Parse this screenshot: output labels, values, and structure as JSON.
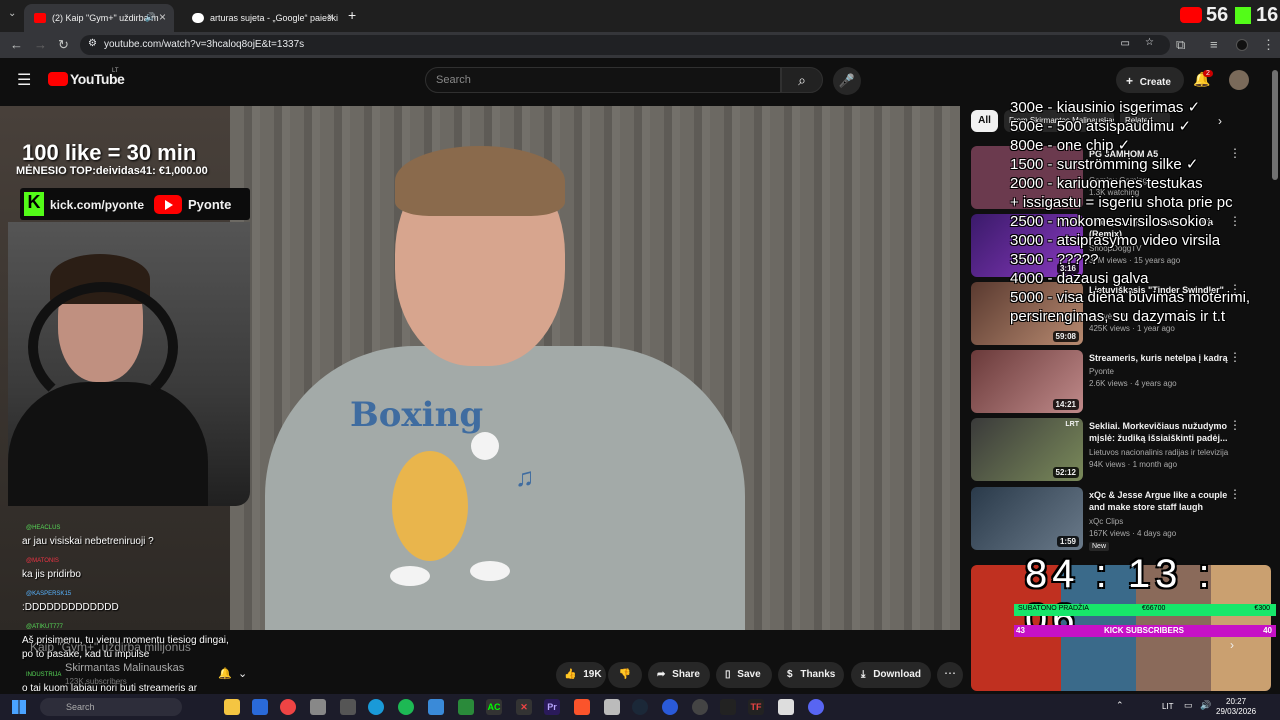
{
  "browser": {
    "tabs": [
      {
        "title": "(2) Kaip \"Gym+\" uždirba m",
        "favicon_color": "#ff0000"
      },
      {
        "title": "arturas sujeta - „Google“ paieški",
        "favicon_color": "#4285f4"
      }
    ],
    "new_tab": "+",
    "url": "youtube.com/watch?v=3hcaloq8ojE&t=1337s"
  },
  "youtube": {
    "logo": "YouTube",
    "logo_country": "LT",
    "search_placeholder": "Search",
    "create_label": "Create",
    "notification_count": "2"
  },
  "stream_overlay": {
    "likes_goal": "100 like = 30 min",
    "month_top": "MĖNESIO TOP:deividas41: €1,000.00",
    "kick_url": "kick.com/pyonte",
    "yt_channel": "Pyonte",
    "counter": "56",
    "counter_k": "16",
    "goals": [
      "300e - kiausinio isgerimas ✓",
      "500e - 500 atsispaudimu ✓",
      "800e - one chip ✓",
      "1500 - surströmming silke ✓",
      "2000 - kariuomenes testukas",
      "+ issigastu = isgeriu shota prie pc",
      "2500 - mokomesvirsilos sokio:",
      "3000 - atsiprasymo video virsila",
      "3500 - ?????",
      "4000 - dazausi galva",
      "5000 - visa diena buvimas moterimi,",
      "persirengimas, su dazymais ir t.t"
    ],
    "timer": "84 : 13 : 06",
    "subathon_label": "SUBATONO PRADŽIA",
    "subathon_mid": "€66700",
    "subathon_right": "€300",
    "kick_subs_left": "43",
    "kick_subs_label": "KICK SUBSCRIBERS",
    "kick_subs_right": "40",
    "chat": [
      {
        "user": "@HEACLUS",
        "text": "ar jau visiskai nebetreniruoji ?"
      },
      {
        "user": "@MATONIS",
        "text": "ka jis pridirbo"
      },
      {
        "user": "@KASPERSK15",
        "text": ":DDDDDDDDDDDDD"
      },
      {
        "user": "@ATIKUT777",
        "text": "Aš prisimenu, tu vienu momentu tiesiog dingai, po to pasake, kad tu impulse"
      },
      {
        "user": "INDUSTRIJA",
        "text": "o tai kuom labiau nori buti streameris ar treneris?"
      }
    ],
    "ghost_title": "Kaip \"Gym+\" uždirba milijonus",
    "ghost_channel": "Skirmantas Malinauskas",
    "ghost_subs": "123K subscribers"
  },
  "video_actions": {
    "likes": "19K",
    "share": "Share",
    "save": "Save",
    "thanks": "Thanks",
    "download": "Download"
  },
  "sidebar": {
    "chips": [
      "All",
      "From Skirmantas Malinauskas",
      "Related"
    ],
    "videos": [
      {
        "title": "PG 3AMHOM A5",
        "channel": "Gaminu Gaming",
        "meta": "1.3K watching",
        "duration": "",
        "thumb": "#6b3a4e"
      },
      {
        "title": "Snoop Dogg vs David Guetta (Remix)",
        "channel": "SnoopDoggTV",
        "meta": "37M views · 15 years ago",
        "duration": "3:16",
        "thumb": "#5a2b8a"
      },
      {
        "title": "Lietuviškasis \"Tinder Swindler\"",
        "channel": "Laisvės TV",
        "meta": "425K views · 1 year ago",
        "duration": "59:08",
        "thumb": "#7a5a50"
      },
      {
        "title": "Streameris, kuris netelpa į kadrą",
        "channel": "Pyonte",
        "meta": "2.6K views · 4 years ago",
        "duration": "14:21",
        "thumb": "#9a6a6a"
      },
      {
        "title": "Sekliai. Morkevičiaus nužudymo mįslė: žudiką išsiaiškinti padėj...",
        "channel": "Lietuvos nacionalinis radijas ir televizija",
        "meta": "94K views · 1 month ago",
        "duration": "52:12",
        "thumb": "#5e6a4a"
      },
      {
        "title": "xQc & Jesse Argue like a couple and make store staff laugh",
        "channel": "xQc Clips",
        "meta": "167K views · 4 days ago",
        "duration": "1:59",
        "thumb": "#4a5a6a",
        "badge": "New"
      }
    ]
  },
  "taskbar": {
    "search": "Search",
    "lang": "LIT",
    "time": "20:27",
    "date": "29/03/2026"
  }
}
